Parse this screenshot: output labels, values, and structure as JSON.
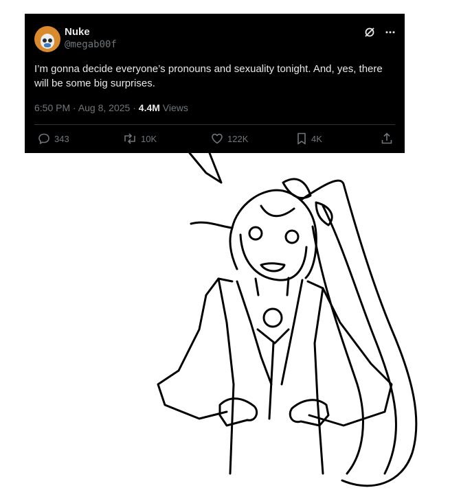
{
  "tweet": {
    "author_name": "Nuke",
    "author_handle": "@megab00f",
    "text": "I’m gonna decide everyone’s pronouns and sexuality tonight. And, yes, there will be some big surprises.",
    "time": "6:50 PM",
    "date": "Aug 8, 2025",
    "views_count": "4.4M",
    "views_label": "Views",
    "replies": "343",
    "reposts": "10K",
    "likes": "122K",
    "bookmarks": "4K"
  },
  "colors": {
    "tweet_bg": "#000000",
    "text_primary": "#e7e9ea",
    "text_secondary": "#71767b",
    "page_bg": "#ffffff"
  },
  "icons": [
    "grok-slash-icon",
    "more-icon",
    "reply-icon",
    "repost-icon",
    "like-icon",
    "bookmark-icon",
    "share-icon"
  ]
}
